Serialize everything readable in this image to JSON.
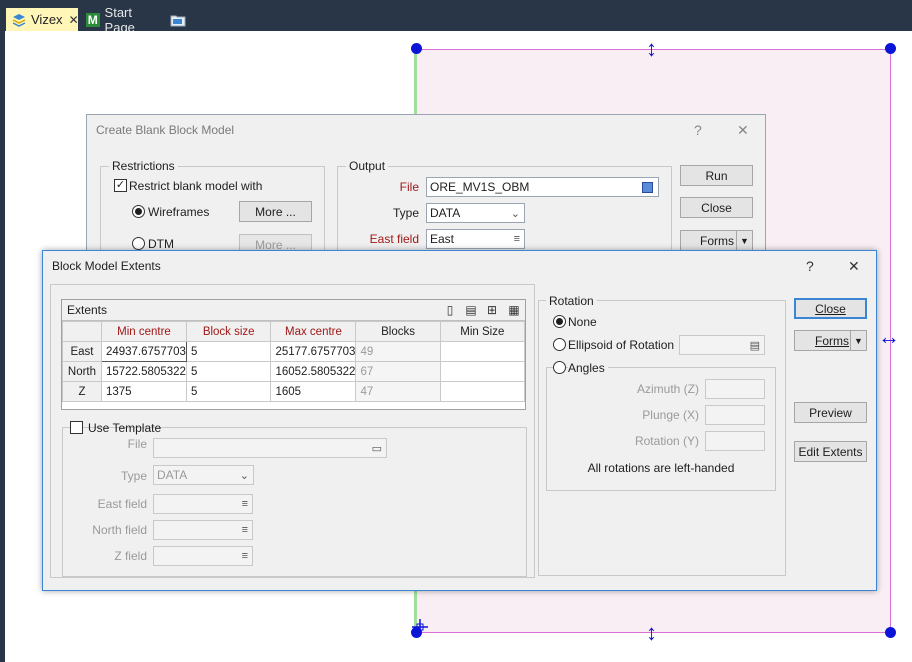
{
  "tabs": [
    {
      "label": "Vizex",
      "icon": "layers-icon",
      "closable": true
    },
    {
      "label": "Start Page",
      "icon": "m-logo-icon"
    },
    {
      "icon": "folder-icon"
    }
  ],
  "create_dialog": {
    "title": "Create Blank Block Model",
    "help": "?",
    "close": "✕",
    "restrictions": {
      "label": "Restrictions",
      "checkbox_label": "Restrict blank model with",
      "wireframes_label": "Wireframes",
      "dtm_label": "DTM",
      "more_label": "More ...",
      "more_disabled_label": "More ..."
    },
    "output": {
      "label": "Output",
      "file_label": "File",
      "file_value": "ORE_MV1S_OBM",
      "type_label": "Type",
      "type_value": "DATA",
      "east_label": "East field",
      "east_value": "East"
    },
    "run_label": "Run",
    "close_label": "Close",
    "forms_label": "Forms"
  },
  "extents_dialog": {
    "title": "Block Model Extents",
    "help": "?",
    "close": "✕",
    "grid": {
      "title": "Extents",
      "columns": [
        "",
        "Min centre",
        "Block size",
        "Max centre",
        "Blocks",
        "Min Size"
      ],
      "rows": [
        {
          "name": "East",
          "min": "24937.67577030",
          "size": "5",
          "max": "25177.67577030",
          "blocks": "49",
          "minsize": ""
        },
        {
          "name": "North",
          "min": "15722.58053221",
          "size": "5",
          "max": "16052.58053221",
          "blocks": "67",
          "minsize": ""
        },
        {
          "name": "Z",
          "min": "1375",
          "size": "5",
          "max": "1605",
          "blocks": "47",
          "minsize": ""
        }
      ]
    },
    "template": {
      "checkbox_label": "Use Template",
      "file_label": "File",
      "type_label": "Type",
      "type_value": "DATA",
      "east_label": "East field",
      "north_label": "North field",
      "z_label": "Z field"
    },
    "rotation": {
      "label": "Rotation",
      "none_label": "None",
      "ellipsoid_label": "Ellipsoid of Rotation",
      "angles_label": "Angles",
      "azimuth_label": "Azimuth (Z)",
      "plunge_label": "Plunge (X)",
      "rotation_label": "Rotation (Y)",
      "note": "All rotations are left-handed"
    },
    "close_label": "Close",
    "forms_label": "Forms",
    "preview_label": "Preview",
    "edit_extents_label": "Edit Extents"
  },
  "colors": {
    "accent": "#3a86d4",
    "handle": "#0a13d8",
    "extent_border": "#d86fd6",
    "required_label": "#a01818"
  }
}
